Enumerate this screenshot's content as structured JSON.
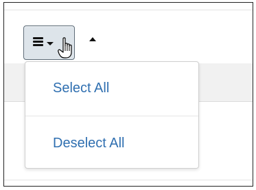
{
  "toolbar": {
    "menu_button_icon": "hamburger-menu-icon",
    "dropdown_indicator_icon": "caret-down-icon",
    "sort_indicator_icon": "caret-up-icon"
  },
  "dropdown": {
    "items": [
      {
        "label": "Select All"
      },
      {
        "label": "Deselect All"
      }
    ]
  },
  "colors": {
    "link": "#2f6fb0",
    "button_bg": "#dde4ea",
    "button_border": "#5d6b77",
    "row_bg": "#f1f1f1"
  }
}
